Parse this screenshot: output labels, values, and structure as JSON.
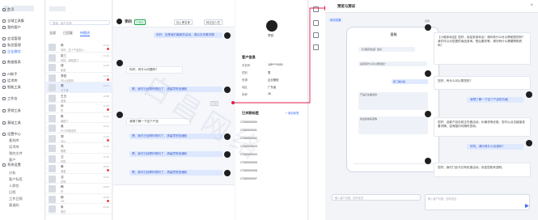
{
  "nav": {
    "items": [
      {
        "label": "首页"
      },
      {
        "label": "全域工具集"
      },
      {
        "label": "我的客户"
      },
      {
        "label": "会话管理"
      },
      {
        "label": "私信管理"
      },
      {
        "label": "企业微信"
      },
      {
        "label": "数据报表"
      },
      {
        "label": "AI助手"
      },
      {
        "label": "话术库"
      },
      {
        "label": "智能工具"
      },
      {
        "label": "工作台"
      },
      {
        "label": "营销工具"
      },
      {
        "label": "基础工具"
      },
      {
        "label": "设置中心"
      },
      {
        "label": "系统设置"
      }
    ],
    "subs": [
      "素材库",
      "话术库",
      "我的文件",
      "客户",
      "分析",
      "客户标签",
      "人群包",
      "日程",
      "工作日报",
      "渠道码"
    ]
  },
  "list": {
    "search_placeholder": "搜索：客户名称",
    "tabs": [
      "全部",
      "已回复",
      "待跟进"
    ],
    "rows": [
      {
        "name": "林",
        "msg": "你好，这个产品怎么...",
        "time": "14:22"
      },
      {
        "name": "张三",
        "msg": "好的，我知道了",
        "time": "14:10"
      },
      {
        "name": "钱",
        "msg": "谢谢",
        "time": "13:55"
      },
      {
        "name": "李四",
        "msg": "可以优惠吗",
        "time": "13:40"
      },
      {
        "name": "周",
        "msg": "已下单",
        "time": "13:21"
      },
      {
        "name": "王五",
        "msg": "收到",
        "time": "12:58"
      },
      {
        "name": "孙",
        "msg": "好",
        "time": "12:40"
      },
      {
        "name": "陈",
        "msg": "麻烦了",
        "time": "12:30"
      },
      {
        "name": "吴",
        "msg": "什么时候发货",
        "time": "12:12"
      },
      {
        "name": "郑",
        "msg": "可以",
        "time": "11:50"
      },
      {
        "name": "冯",
        "msg": "嗯嗯",
        "time": "11:32"
      },
      {
        "name": "卫",
        "msg": "好的",
        "time": "11:10"
      },
      {
        "name": "蒋",
        "msg": "谢谢",
        "time": "10:55"
      },
      {
        "name": "沈",
        "msg": "在吗",
        "time": "10:40"
      },
      {
        "name": "韩",
        "msg": "好",
        "time": "10:20"
      },
      {
        "name": "杨",
        "msg": "OK",
        "time": "10:05"
      },
      {
        "name": "朱",
        "msg": "明白",
        "time": "09:48"
      }
    ]
  },
  "chat": {
    "contact": "李四",
    "tag": "已添加",
    "btn1": "加入黑名单",
    "btn2": "转交至人员",
    "msgs": [
      {
        "text": "你好，这是我们最新的活动，",
        "side": "me"
      },
      {
        "text": "请点击查看详情",
        "side": "me"
      },
      {
        "text": "你好，有什么问题吗？",
        "side": "other"
      },
      {
        "text": "嗯，我们已经帮你预约了，请留意短信通知",
        "side": "me"
      },
      {
        "text": "请稍等",
        "side": "time"
      },
      {
        "text": "我想了解一下这个产品",
        "side": "other"
      },
      {
        "text": "嗯，我们已经帮你预约了，请留意短信通知",
        "side": "me"
      },
      {
        "text": "嗯，我们已经帮你预约了，请留意短信通知",
        "side": "me"
      },
      {
        "text": "嗯，我们已经帮你预约了，请留意短信通知",
        "side": "me"
      }
    ],
    "read_label": "已读"
  },
  "info": {
    "name": "李四",
    "section1": "客户信息",
    "fields": [
      {
        "k": "手机号",
        "v": "185****0000"
      },
      {
        "k": "性别",
        "v": "男"
      },
      {
        "k": "来源",
        "v": "企业微信"
      },
      {
        "k": "地区",
        "v": "广东省"
      },
      {
        "k": "年龄",
        "v": "28"
      }
    ],
    "section2": "已关联标签",
    "add_label": "+ 添加标签",
    "tags": [
      "17000000000",
      "17000000001",
      "17000000002",
      "17000000003",
      "17000000004",
      "17000000005",
      "17000000006",
      "17000000007"
    ]
  },
  "right": {
    "title": "预览与测试",
    "subtab": "网页效果",
    "phone_title": "客服",
    "msgs": [
      {
        "text": "【小程序欢迎】您好，欢迎来到本店！请问有什么可以帮助您的吗？我们可以为您提供商品咨询、售后服务等，请问有什么需要帮助的吗？",
        "who": "bot"
      },
      {
        "text": "您好，有什么可以帮您的？",
        "who": "bot"
      },
      {
        "text": "我想了解一下这个产品的价格",
        "who": "me"
      },
      {
        "text": "您好，这款产品目前正在做活动，价格非常优惠，您可以点击链接查看详情，如有疑问可随时咨询。",
        "who": "bot"
      },
      {
        "text": "好的，请问有什么优惠吗？",
        "who": "me"
      },
      {
        "text": "您好，我们门店今日有优惠活动，欢迎您前来选购。",
        "who": "bot"
      }
    ],
    "input_placeholder": "输入客户问题，回车发送",
    "accent": "#3b6cf6"
  },
  "watermark": "白昌网络"
}
